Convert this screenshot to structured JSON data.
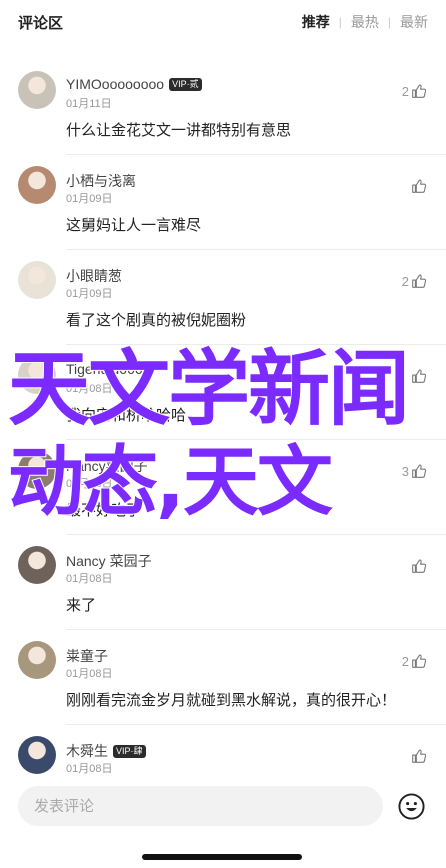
{
  "header": {
    "title": "评论区",
    "tabs": [
      {
        "label": "推荐",
        "active": true
      },
      {
        "label": "最热",
        "active": false
      },
      {
        "label": "最新",
        "active": false
      }
    ]
  },
  "comments": [
    {
      "name": "YIMOoooooooo",
      "vip": "VIP·贰",
      "date": "01月11日",
      "text": "什么让金花艾文一讲都特别有意思",
      "likes": "2",
      "avatar_color": "#c9c2b8"
    },
    {
      "name": "小栖与浅离",
      "vip": "",
      "date": "01月09日",
      "text": "这舅妈让人一言难尽",
      "likes": "",
      "avatar_color": "#b58a70"
    },
    {
      "name": "小眼睛葱",
      "vip": "",
      "date": "01月09日",
      "text": "看了这个剧真的被倪妮圈粉",
      "likes": "2",
      "avatar_color": "#e8e3d6"
    },
    {
      "name": "Tigerlulu666",
      "vip": "",
      "date": "01月08日",
      "text": "我向安和桥哈哈哈",
      "likes": "",
      "avatar_color": "#d9d0c6"
    },
    {
      "name": "Nancy菜园子",
      "vip": "",
      "date": "01月08日",
      "text": "最不好吃了",
      "likes": "3",
      "avatar_color": "#8d7b6f"
    },
    {
      "name": "Nancy 菜园子",
      "vip": "",
      "date": "01月08日",
      "text": "来了",
      "likes": "",
      "avatar_color": "#6f625a"
    },
    {
      "name": "粜童子",
      "vip": "",
      "date": "01月08日",
      "text": "刚刚看完流金岁月就碰到黑水解说，真的很开心！",
      "likes": "2",
      "avatar_color": "#a6977d"
    },
    {
      "name": "木舜生",
      "vip": "VIP·肆",
      "date": "01月08日",
      "text": "",
      "likes": "",
      "avatar_color": "#3a4a6a"
    }
  ],
  "input": {
    "placeholder": "发表评论"
  },
  "watermark": {
    "line1": "天文学新闻",
    "line2": "动态,天文"
  },
  "colors": {
    "watermark": "#7b2bff"
  }
}
